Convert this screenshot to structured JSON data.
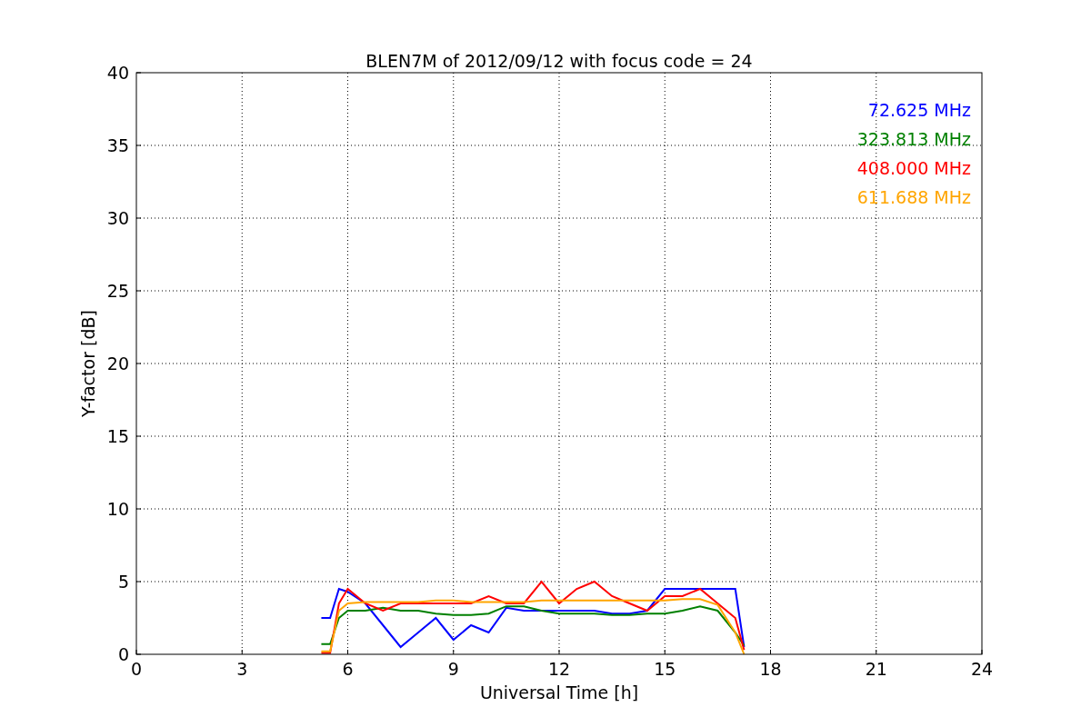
{
  "chart_data": {
    "type": "line",
    "title": "BLEN7M of 2012/09/12 with focus code = 24",
    "xlabel": "Universal Time [h]",
    "ylabel": "Y-factor [dB]",
    "x": [
      5.25,
      5.5,
      5.75,
      6,
      6.5,
      7,
      7.5,
      8,
      8.5,
      9,
      9.5,
      10,
      10.5,
      11,
      11.5,
      12,
      12.5,
      13,
      13.5,
      14,
      14.5,
      15,
      15.5,
      16,
      16.5,
      17,
      17.25
    ],
    "series": [
      {
        "name": "72.625 MHz",
        "color": "#0000ff",
        "values": [
          2.5,
          2.5,
          4.5,
          4.3,
          3.5,
          2,
          0.5,
          1.5,
          2.5,
          1,
          2,
          1.5,
          3.2,
          3,
          3,
          3,
          3,
          3,
          2.8,
          2.8,
          3,
          4.5,
          4.5,
          4.5,
          4.5,
          4.5,
          0.5
        ]
      },
      {
        "name": "323.813 MHz",
        "color": "#008000",
        "values": [
          0.7,
          0.7,
          2.5,
          3,
          3,
          3.2,
          3,
          3,
          2.8,
          2.7,
          2.7,
          2.8,
          3.3,
          3.3,
          3,
          2.8,
          2.8,
          2.8,
          2.7,
          2.7,
          2.8,
          2.8,
          3,
          3.3,
          3,
          1.5,
          0.6
        ]
      },
      {
        "name": "408.000 MHz",
        "color": "#ff0000",
        "values": [
          0.1,
          0.1,
          3.5,
          4.5,
          3.5,
          3,
          3.5,
          3.5,
          3.5,
          3.5,
          3.5,
          4,
          3.5,
          3.5,
          5,
          3.5,
          4.5,
          5,
          4,
          3.5,
          3,
          4,
          4,
          4.5,
          3.5,
          2.5,
          0.3
        ]
      },
      {
        "name": "611.688 MHz",
        "color": "#ffa500",
        "values": [
          0.2,
          0.2,
          3,
          3.5,
          3.6,
          3.6,
          3.6,
          3.6,
          3.7,
          3.7,
          3.6,
          3.6,
          3.6,
          3.6,
          3.7,
          3.7,
          3.7,
          3.7,
          3.7,
          3.7,
          3.7,
          3.7,
          3.8,
          3.8,
          3.4,
          1.5,
          0
        ]
      }
    ],
    "xlim": [
      0,
      24
    ],
    "ylim": [
      0,
      40
    ],
    "xticks": [
      0,
      3,
      6,
      9,
      12,
      15,
      18,
      21,
      24
    ],
    "yticks": [
      0,
      5,
      10,
      15,
      20,
      25,
      30,
      35,
      40
    ],
    "grid": true
  }
}
